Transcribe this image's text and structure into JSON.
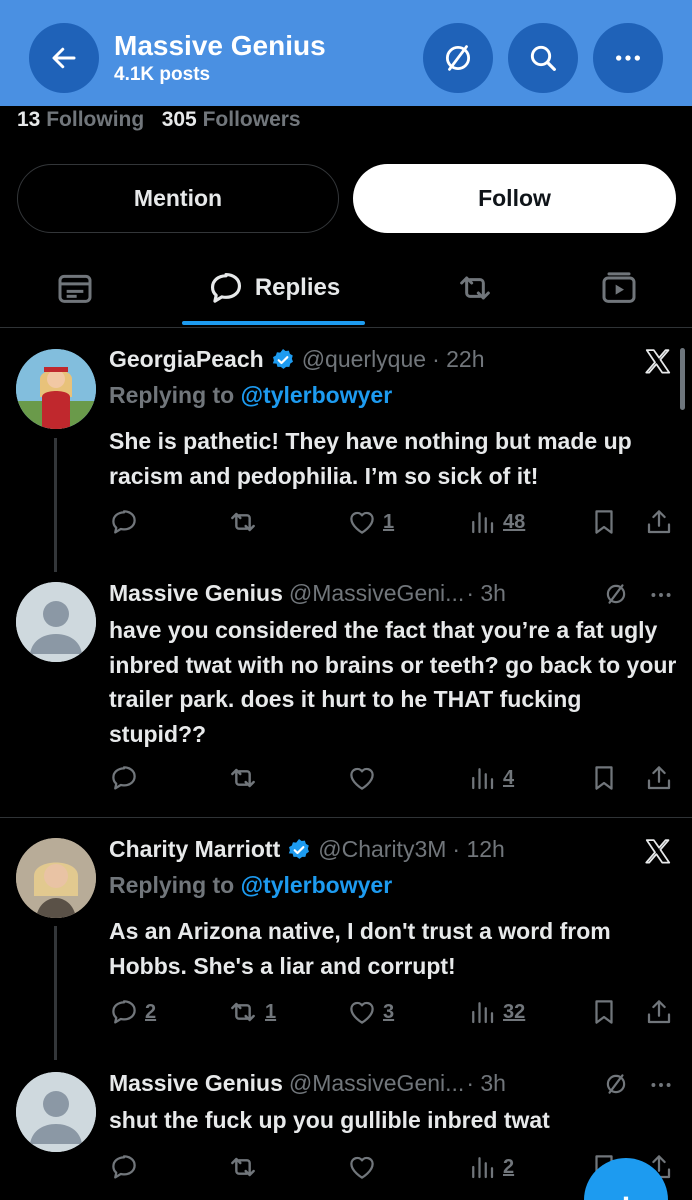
{
  "header": {
    "title": "Massive Genius",
    "posts": "4.1K posts",
    "icons": [
      "back-arrow-icon",
      "slashed-circle-icon",
      "search-icon",
      "more-icon"
    ],
    "colors": {
      "bar": "#4a90e2",
      "button": "#1f62b8"
    }
  },
  "stats": {
    "following_count": "13",
    "following_label": "Following",
    "followers_count": "305",
    "followers_label": "Followers"
  },
  "buttons": {
    "mention": "Mention",
    "follow": "Follow"
  },
  "tabs": {
    "items": [
      "posts-tab-icon",
      "Replies",
      "repost-tab-icon",
      "media-tab-icon"
    ],
    "active": "Replies"
  },
  "posts": [
    {
      "name": "GeorgiaPeach",
      "verified": true,
      "handle": "@querlyque",
      "time": "· 22h",
      "replying_prefix": "Replying to",
      "replying_to": "@tylerbowyer",
      "text": "She is pathetic! They have nothing but made up racism and pedophilia. I’m so sick of it!",
      "replies": "",
      "reposts": "",
      "likes": "1",
      "views": "48"
    },
    {
      "name": "Massive Genius",
      "verified": false,
      "handle": "@MassiveGeni...",
      "time": "· 3h",
      "text": "have you considered the fact that you’re a fat ugly inbred twat with no brains or teeth? go back to your trailer park. does it hurt to he THAT fucking stupid??",
      "replies": "",
      "reposts": "",
      "likes": "",
      "views": "4"
    },
    {
      "name": "Charity Marriott",
      "verified": true,
      "handle": "@Charity3M",
      "time": "· 12h",
      "replying_prefix": "Replying to",
      "replying_to": "@tylerbowyer",
      "text": "As an Arizona native, I don't trust a word from Hobbs.  She's a liar and corrupt!",
      "replies": "2",
      "reposts": "1",
      "likes": "3",
      "views": "32"
    },
    {
      "name": "Massive Genius",
      "verified": false,
      "handle": "@MassiveGeni...",
      "time": "· 3h",
      "text": "shut the fuck up you gullible inbred twat",
      "replies": "",
      "reposts": "",
      "likes": "",
      "views": "2"
    }
  ],
  "fab": {
    "label": "+",
    "color": "#1d9bf0"
  }
}
